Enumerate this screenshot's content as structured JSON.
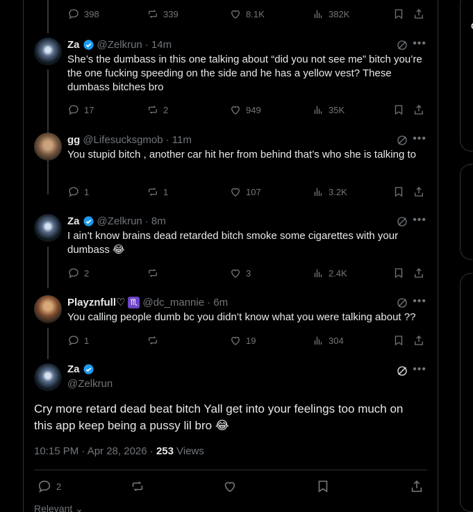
{
  "top_actions": {
    "replies": "398",
    "reposts": "339",
    "likes": "8.1K",
    "views": "382K"
  },
  "tweets": [
    {
      "avatar": "za",
      "name": "Za",
      "verified": true,
      "handle": "@Zelkrun",
      "time": "· 14m",
      "text": "She’s the dumbass in this one talking about “did you not see me” bitch you’re the one fucking speeding on the side and he has a yellow vest? These dumbass bitches bro",
      "replies": "17",
      "reposts": "2",
      "likes": "949",
      "views": "35K"
    },
    {
      "avatar": "gg",
      "name": "gg",
      "verified": false,
      "handle": "@Lifesucksgmob",
      "time": "· 11m",
      "text": "You stupid bitch , another car hit her from behind that’s who she is talking to",
      "replies": "1",
      "reposts": "1",
      "likes": "107",
      "views": "3.2K"
    },
    {
      "avatar": "za",
      "name": "Za",
      "verified": true,
      "handle": "@Zelkrun",
      "time": "· 8m",
      "text": "I ain’t know brains dead retarded bitch smoke some cigarettes with your dumbass 😂",
      "replies": "2",
      "reposts": "",
      "likes": "3",
      "views": "2.4K"
    },
    {
      "avatar": "pl",
      "name": "Playznfull♡",
      "sign": "♏",
      "verified": false,
      "handle": "@dc_mannie",
      "time": "· 6m",
      "text": "You calling people dumb bc you didn’t know what you were talking about ??",
      "replies": "1",
      "reposts": "",
      "likes": "19",
      "views": "304"
    }
  ],
  "main": {
    "name": "Za",
    "handle": "@Zelkrun",
    "text": "Cry more retard dead beat bitch Yall get into your feelings too much on this app keep being a pussy lil bro 😂",
    "time": "10:15 PM · Apr 28, 2026 · ",
    "views_count": "253",
    "views_label": " Views",
    "replies": "2",
    "sort_label": "Relevant"
  },
  "icons": [
    "reply-icon",
    "repost-icon",
    "like-icon",
    "views-icon",
    "bookmark-icon",
    "share-icon",
    "grok-icon",
    "more-icon",
    "verified-icon"
  ],
  "colors": {
    "background": "#000000",
    "text": "#e7e9ea",
    "muted": "#71767b",
    "border": "#2f3336",
    "verified": "#1d9bf0"
  }
}
